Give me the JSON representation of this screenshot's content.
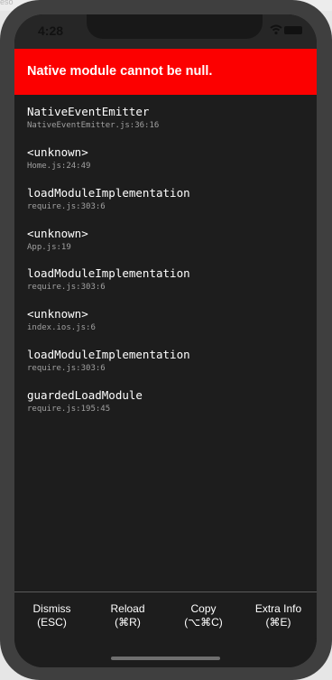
{
  "status_bar": {
    "time": "4:28",
    "wifi_icon": "wifi-icon",
    "battery_icon": "battery-icon"
  },
  "error": {
    "message": "Native module cannot be null.",
    "color": "#fc0000"
  },
  "stack_frames": [
    {
      "method": "NativeEventEmitter",
      "location": "NativeEventEmitter.js:36:16"
    },
    {
      "method": "<unknown>",
      "location": "Home.js:24:49"
    },
    {
      "method": "loadModuleImplementation",
      "location": "require.js:303:6"
    },
    {
      "method": "<unknown>",
      "location": "App.js:19"
    },
    {
      "method": "loadModuleImplementation",
      "location": "require.js:303:6"
    },
    {
      "method": "<unknown>",
      "location": "index.ios.js:6"
    },
    {
      "method": "loadModuleImplementation",
      "location": "require.js:303:6"
    },
    {
      "method": "guardedLoadModule",
      "location": "require.js:195:45"
    }
  ],
  "toolbar": {
    "dismiss": {
      "label": "Dismiss",
      "shortcut": "(ESC)"
    },
    "reload": {
      "label": "Reload",
      "shortcut": "(⌘R)"
    },
    "copy": {
      "label": "Copy",
      "shortcut": "(⌥⌘C)"
    },
    "extra_info": {
      "label": "Extra Info",
      "shortcut": "(⌘E)"
    }
  },
  "background_text": {
    "left_fragment": "eso"
  }
}
